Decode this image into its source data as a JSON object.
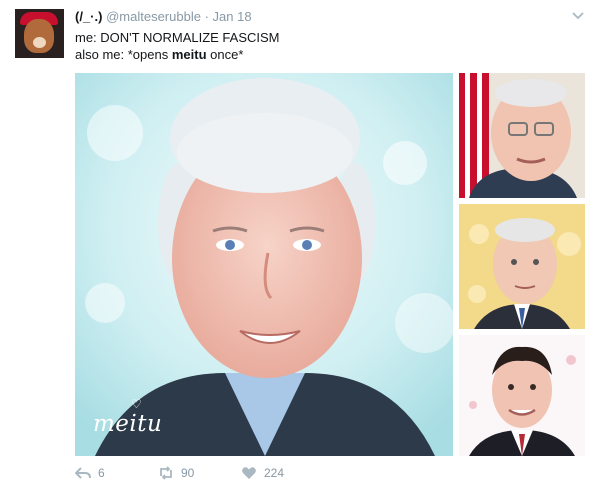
{
  "tweet": {
    "author_name": "(/_·.)",
    "handle": "@malteserubble",
    "separator": "·",
    "date": "Jan 18",
    "line1": "me: DON'T NORMALIZE FASCISM",
    "line2_prefix": "also me: *opens ",
    "line2_bold": "meitu",
    "line2_suffix": " once*",
    "watermark": "meitu"
  },
  "actions": {
    "reply_count": "6",
    "retweet_count": "90",
    "like_count": "224"
  },
  "icons": {
    "more": "chevron-down-icon",
    "reply": "reply-icon",
    "retweet": "retweet-icon",
    "like": "heart-icon"
  },
  "colors": {
    "muted": "#8899a6",
    "text": "#14171a"
  }
}
